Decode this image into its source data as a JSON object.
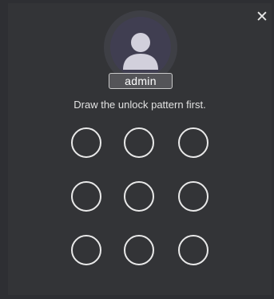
{
  "dialog": {
    "close_glyph": "✕",
    "close_icon": "close-icon"
  },
  "user": {
    "avatar_icon": "user-avatar-icon",
    "username": "admin"
  },
  "instruction": "Draw the unlock pattern first.",
  "pattern": {
    "rows": 3,
    "columns": 3,
    "points": [
      1,
      2,
      3,
      4,
      5,
      6,
      7,
      8,
      9
    ]
  },
  "colors": {
    "background": "#333437",
    "avatar_ring": "#3e3f45",
    "avatar_disc": "#403e51",
    "avatar_figure": "#d2d0dc",
    "badge_background": "#545458",
    "dot_stroke": "#e9e9e9"
  }
}
